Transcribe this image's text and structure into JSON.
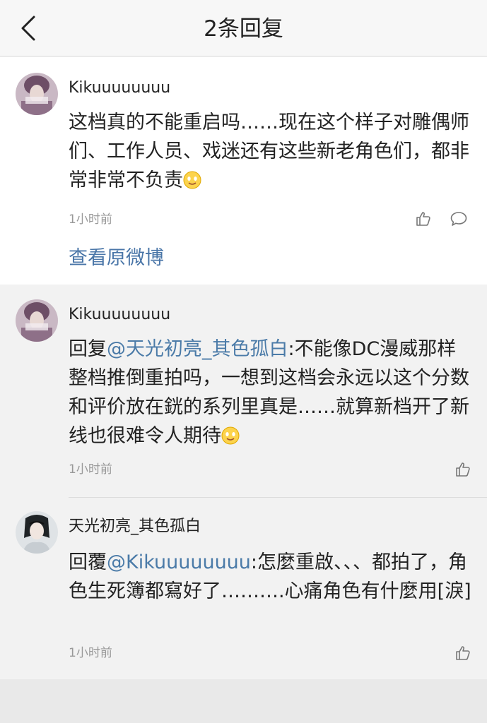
{
  "navbar": {
    "title": "2条回复",
    "back_icon": "chevron-left-icon"
  },
  "main_comment": {
    "username": "Kikuuuuuuuu",
    "text": "这档真的不能重启吗……现在这个样子对雕偶师们、工作人员、戏迷还有这些新老角色们，都非常非常不负责",
    "emoji": "smile-emoji",
    "time": "1小时前",
    "view_original_label": "查看原微博",
    "like_icon": "thumbs-up-icon",
    "comment_icon": "speech-bubble-icon"
  },
  "replies": [
    {
      "username": "Kikuuuuuuuu",
      "reply_prefix": "回复",
      "mention": "@天光初亮_其色孤白",
      "text": ":不能像DC漫威那样整档推倒重拍吗，一想到这档会永远以这个分数和评价放在銧的系列里真是……就算新档开了新线也很难令人期待",
      "emoji": "smile-emoji",
      "time": "1小时前"
    },
    {
      "username": "天光初亮_其色孤白",
      "reply_prefix": "回覆",
      "mention": "@Kikuuuuuuuu",
      "text": ":怎麼重啟、、、都拍了，角色生死簿都寫好了……….心痛角色有什麼用[淚]",
      "time": "1小时前"
    }
  ],
  "colors": {
    "link": "#4b7ba8",
    "meta_text": "#999999",
    "background": "#f2f2f2"
  }
}
